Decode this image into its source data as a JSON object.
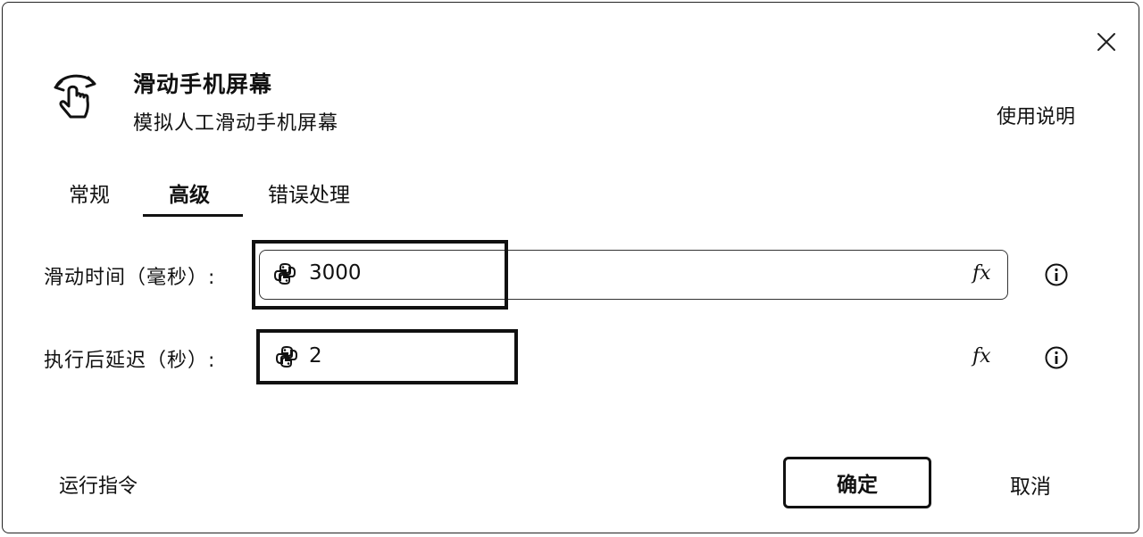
{
  "header": {
    "title": "滑动手机屏幕",
    "subtitle": "模拟人工滑动手机屏幕",
    "help_link": "使用说明",
    "icon": "swipe-hand-icon"
  },
  "tabs": [
    {
      "label": "常规",
      "active": false
    },
    {
      "label": "高级",
      "active": true
    },
    {
      "label": "错误处理",
      "active": false
    }
  ],
  "fields": {
    "swipe_time": {
      "label": "滑动时间（毫秒）:",
      "value": "3000"
    },
    "post_delay": {
      "label": "执行后延迟（秒）:",
      "value": "2"
    }
  },
  "icons": {
    "fx": "fx",
    "close": "close-icon",
    "info": "info-icon",
    "python": "python-icon"
  },
  "footer": {
    "run_command": "运行指令",
    "ok": "确定",
    "cancel": "取消"
  }
}
